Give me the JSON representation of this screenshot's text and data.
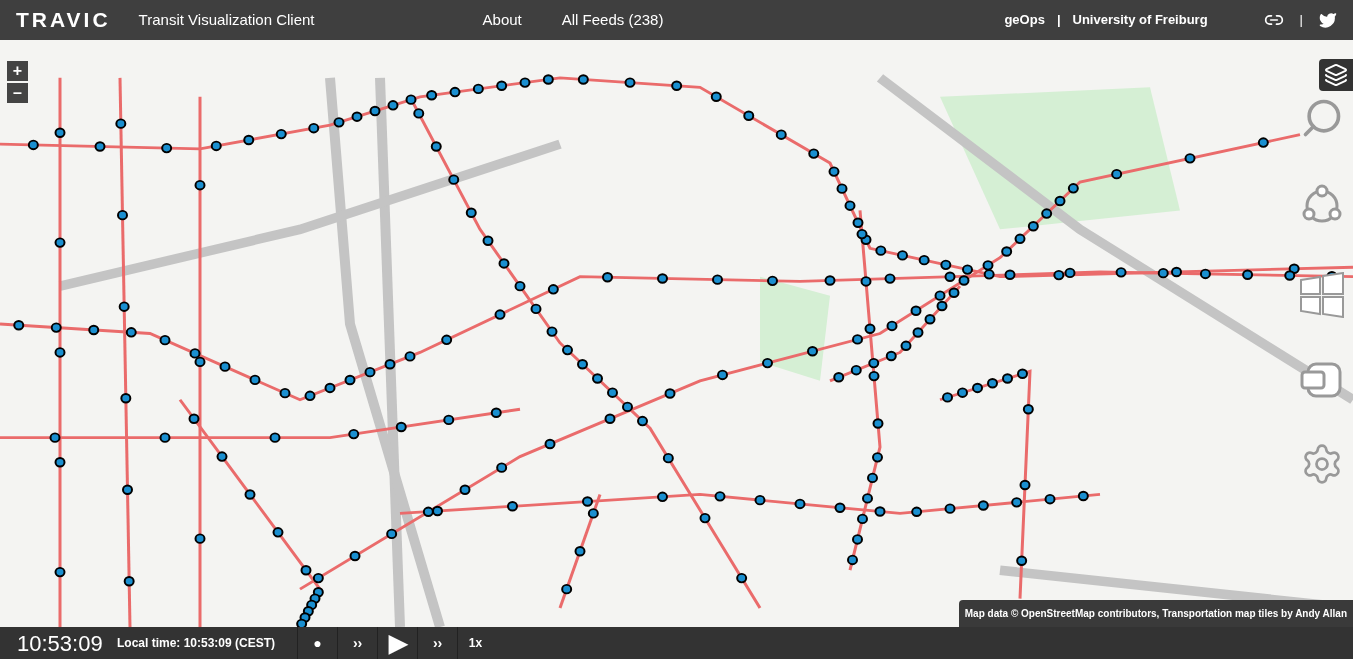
{
  "header": {
    "logo": "TRAVIC",
    "subtitle": "Transit Visualization Client",
    "nav": [
      "About",
      "All Feeds (238)"
    ],
    "links": [
      "geOps",
      "University of Freiburg"
    ],
    "link_separator": "|",
    "icon_separator": "|"
  },
  "map": {
    "zoom_controls": [
      "+",
      "–"
    ],
    "attribution": "Map data © OpenStreetMap contributors, Transportation map tiles by Andy Allan"
  },
  "footer": {
    "clock": "10:53:09",
    "local_time": "Local time: 10:53:09 (CEST)",
    "controls": [
      "●",
      "››",
      "▶",
      "››",
      "1x"
    ]
  }
}
